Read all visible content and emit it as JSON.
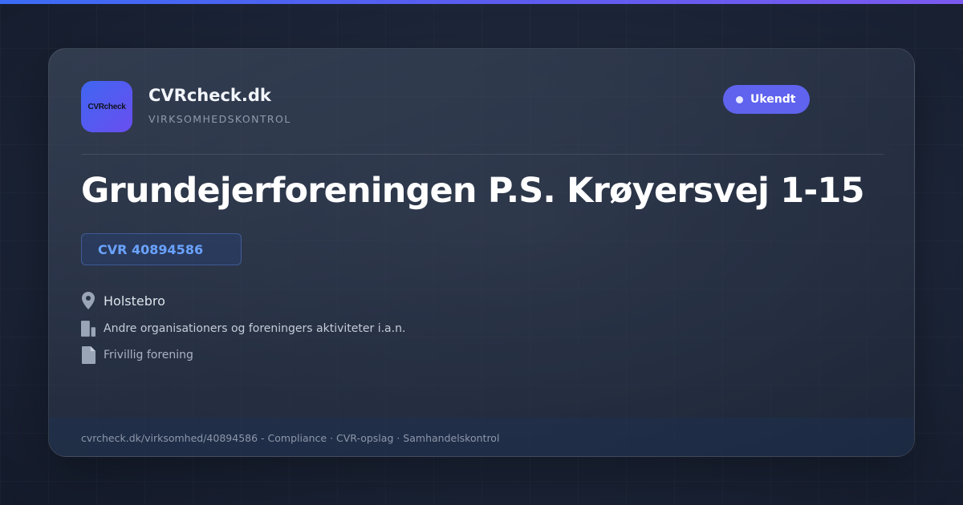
{
  "brand": {
    "logo_text": "CVRcheck",
    "name": "CVRcheck.dk",
    "subtitle": "VIRKSOMHEDSKONTROL"
  },
  "status": {
    "label": "Ukendt"
  },
  "company": {
    "name": "Grundejerforeningen P.S. Krøyersvej 1-15",
    "cvr_label": "CVR 40894586"
  },
  "details": {
    "city": "Holstebro",
    "industry": "Andre organisationers og foreningers aktiviteter i.a.n.",
    "company_type": "Frivillig forening"
  },
  "footer": {
    "text": "cvrcheck.dk/virksomhed/40894586 - Compliance · CVR-opslag · Samhandelskontrol"
  },
  "icons": {
    "city": "map-pin-icon",
    "industry": "building-icon",
    "company_type": "document-icon"
  },
  "colors": {
    "accent_gradient_start": "#3b6cf5",
    "accent_gradient_end": "#7b5af0",
    "status_badge": "#5f63ee",
    "cvr_text": "#6aa3ff",
    "background": "#151d2e"
  }
}
